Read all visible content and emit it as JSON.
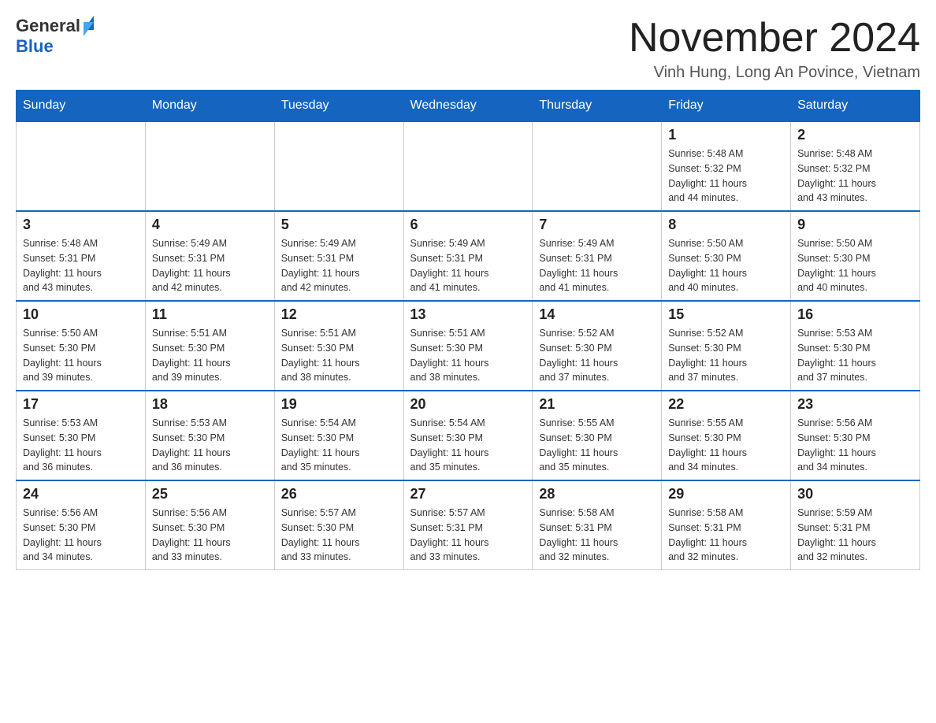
{
  "header": {
    "logo": {
      "general": "General",
      "blue": "Blue"
    },
    "title": "November 2024",
    "location": "Vinh Hung, Long An Povince, Vietnam"
  },
  "weekdays": [
    "Sunday",
    "Monday",
    "Tuesday",
    "Wednesday",
    "Thursday",
    "Friday",
    "Saturday"
  ],
  "weeks": [
    {
      "days": [
        {
          "number": "",
          "info": ""
        },
        {
          "number": "",
          "info": ""
        },
        {
          "number": "",
          "info": ""
        },
        {
          "number": "",
          "info": ""
        },
        {
          "number": "",
          "info": ""
        },
        {
          "number": "1",
          "info": "Sunrise: 5:48 AM\nSunset: 5:32 PM\nDaylight: 11 hours\nand 44 minutes."
        },
        {
          "number": "2",
          "info": "Sunrise: 5:48 AM\nSunset: 5:32 PM\nDaylight: 11 hours\nand 43 minutes."
        }
      ]
    },
    {
      "days": [
        {
          "number": "3",
          "info": "Sunrise: 5:48 AM\nSunset: 5:31 PM\nDaylight: 11 hours\nand 43 minutes."
        },
        {
          "number": "4",
          "info": "Sunrise: 5:49 AM\nSunset: 5:31 PM\nDaylight: 11 hours\nand 42 minutes."
        },
        {
          "number": "5",
          "info": "Sunrise: 5:49 AM\nSunset: 5:31 PM\nDaylight: 11 hours\nand 42 minutes."
        },
        {
          "number": "6",
          "info": "Sunrise: 5:49 AM\nSunset: 5:31 PM\nDaylight: 11 hours\nand 41 minutes."
        },
        {
          "number": "7",
          "info": "Sunrise: 5:49 AM\nSunset: 5:31 PM\nDaylight: 11 hours\nand 41 minutes."
        },
        {
          "number": "8",
          "info": "Sunrise: 5:50 AM\nSunset: 5:30 PM\nDaylight: 11 hours\nand 40 minutes."
        },
        {
          "number": "9",
          "info": "Sunrise: 5:50 AM\nSunset: 5:30 PM\nDaylight: 11 hours\nand 40 minutes."
        }
      ]
    },
    {
      "days": [
        {
          "number": "10",
          "info": "Sunrise: 5:50 AM\nSunset: 5:30 PM\nDaylight: 11 hours\nand 39 minutes."
        },
        {
          "number": "11",
          "info": "Sunrise: 5:51 AM\nSunset: 5:30 PM\nDaylight: 11 hours\nand 39 minutes."
        },
        {
          "number": "12",
          "info": "Sunrise: 5:51 AM\nSunset: 5:30 PM\nDaylight: 11 hours\nand 38 minutes."
        },
        {
          "number": "13",
          "info": "Sunrise: 5:51 AM\nSunset: 5:30 PM\nDaylight: 11 hours\nand 38 minutes."
        },
        {
          "number": "14",
          "info": "Sunrise: 5:52 AM\nSunset: 5:30 PM\nDaylight: 11 hours\nand 37 minutes."
        },
        {
          "number": "15",
          "info": "Sunrise: 5:52 AM\nSunset: 5:30 PM\nDaylight: 11 hours\nand 37 minutes."
        },
        {
          "number": "16",
          "info": "Sunrise: 5:53 AM\nSunset: 5:30 PM\nDaylight: 11 hours\nand 37 minutes."
        }
      ]
    },
    {
      "days": [
        {
          "number": "17",
          "info": "Sunrise: 5:53 AM\nSunset: 5:30 PM\nDaylight: 11 hours\nand 36 minutes."
        },
        {
          "number": "18",
          "info": "Sunrise: 5:53 AM\nSunset: 5:30 PM\nDaylight: 11 hours\nand 36 minutes."
        },
        {
          "number": "19",
          "info": "Sunrise: 5:54 AM\nSunset: 5:30 PM\nDaylight: 11 hours\nand 35 minutes."
        },
        {
          "number": "20",
          "info": "Sunrise: 5:54 AM\nSunset: 5:30 PM\nDaylight: 11 hours\nand 35 minutes."
        },
        {
          "number": "21",
          "info": "Sunrise: 5:55 AM\nSunset: 5:30 PM\nDaylight: 11 hours\nand 35 minutes."
        },
        {
          "number": "22",
          "info": "Sunrise: 5:55 AM\nSunset: 5:30 PM\nDaylight: 11 hours\nand 34 minutes."
        },
        {
          "number": "23",
          "info": "Sunrise: 5:56 AM\nSunset: 5:30 PM\nDaylight: 11 hours\nand 34 minutes."
        }
      ]
    },
    {
      "days": [
        {
          "number": "24",
          "info": "Sunrise: 5:56 AM\nSunset: 5:30 PM\nDaylight: 11 hours\nand 34 minutes."
        },
        {
          "number": "25",
          "info": "Sunrise: 5:56 AM\nSunset: 5:30 PM\nDaylight: 11 hours\nand 33 minutes."
        },
        {
          "number": "26",
          "info": "Sunrise: 5:57 AM\nSunset: 5:30 PM\nDaylight: 11 hours\nand 33 minutes."
        },
        {
          "number": "27",
          "info": "Sunrise: 5:57 AM\nSunset: 5:31 PM\nDaylight: 11 hours\nand 33 minutes."
        },
        {
          "number": "28",
          "info": "Sunrise: 5:58 AM\nSunset: 5:31 PM\nDaylight: 11 hours\nand 32 minutes."
        },
        {
          "number": "29",
          "info": "Sunrise: 5:58 AM\nSunset: 5:31 PM\nDaylight: 11 hours\nand 32 minutes."
        },
        {
          "number": "30",
          "info": "Sunrise: 5:59 AM\nSunset: 5:31 PM\nDaylight: 11 hours\nand 32 minutes."
        }
      ]
    }
  ]
}
